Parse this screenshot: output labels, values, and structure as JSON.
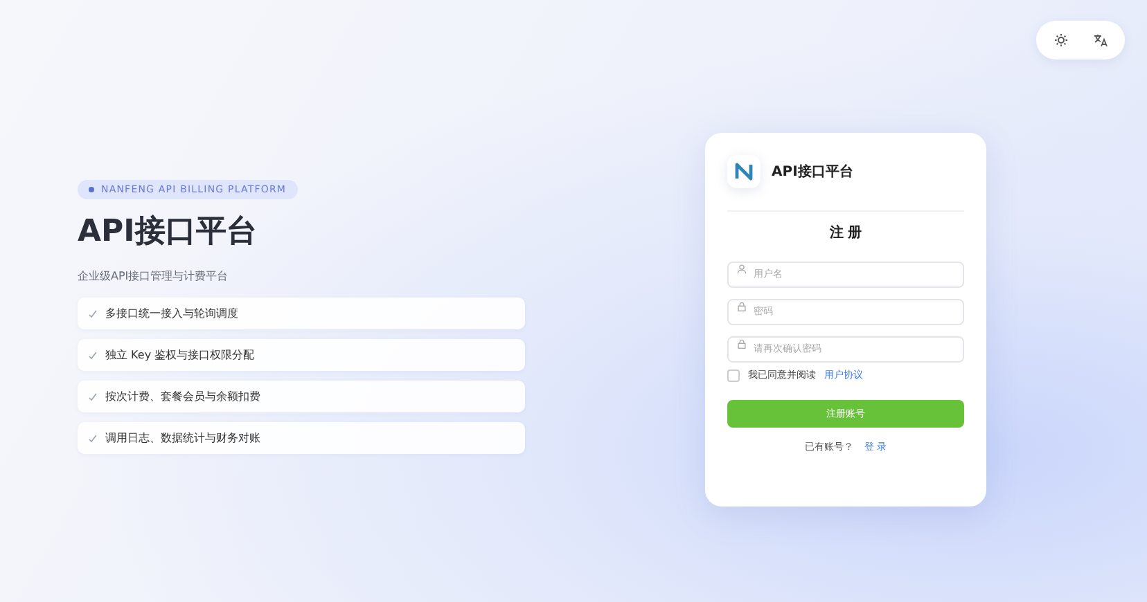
{
  "badge": "NANFENG API BILLING PLATFORM",
  "hero": {
    "title": "API接口平台",
    "subtitle": "企业级API接口管理与计费平台"
  },
  "features": [
    "多接口统一接入与轮询调度",
    "独立 Key 鉴权与接口权限分配",
    "按次计费、套餐会员与余额扣费",
    "调用日志、数据统计与财务对账"
  ],
  "card": {
    "brand": "API接口平台",
    "heading": "注 册",
    "fields": [
      {
        "kind": "user",
        "placeholder": "用户名"
      },
      {
        "kind": "lock",
        "placeholder": "密码"
      },
      {
        "kind": "lock",
        "placeholder": "请再次确认密码"
      }
    ],
    "agreement": {
      "checked": false,
      "text": "我已同意并阅读",
      "link": "用户协议"
    },
    "submit": "注册账号",
    "footer": {
      "text": "已有账号？",
      "link": "登 录"
    }
  }
}
